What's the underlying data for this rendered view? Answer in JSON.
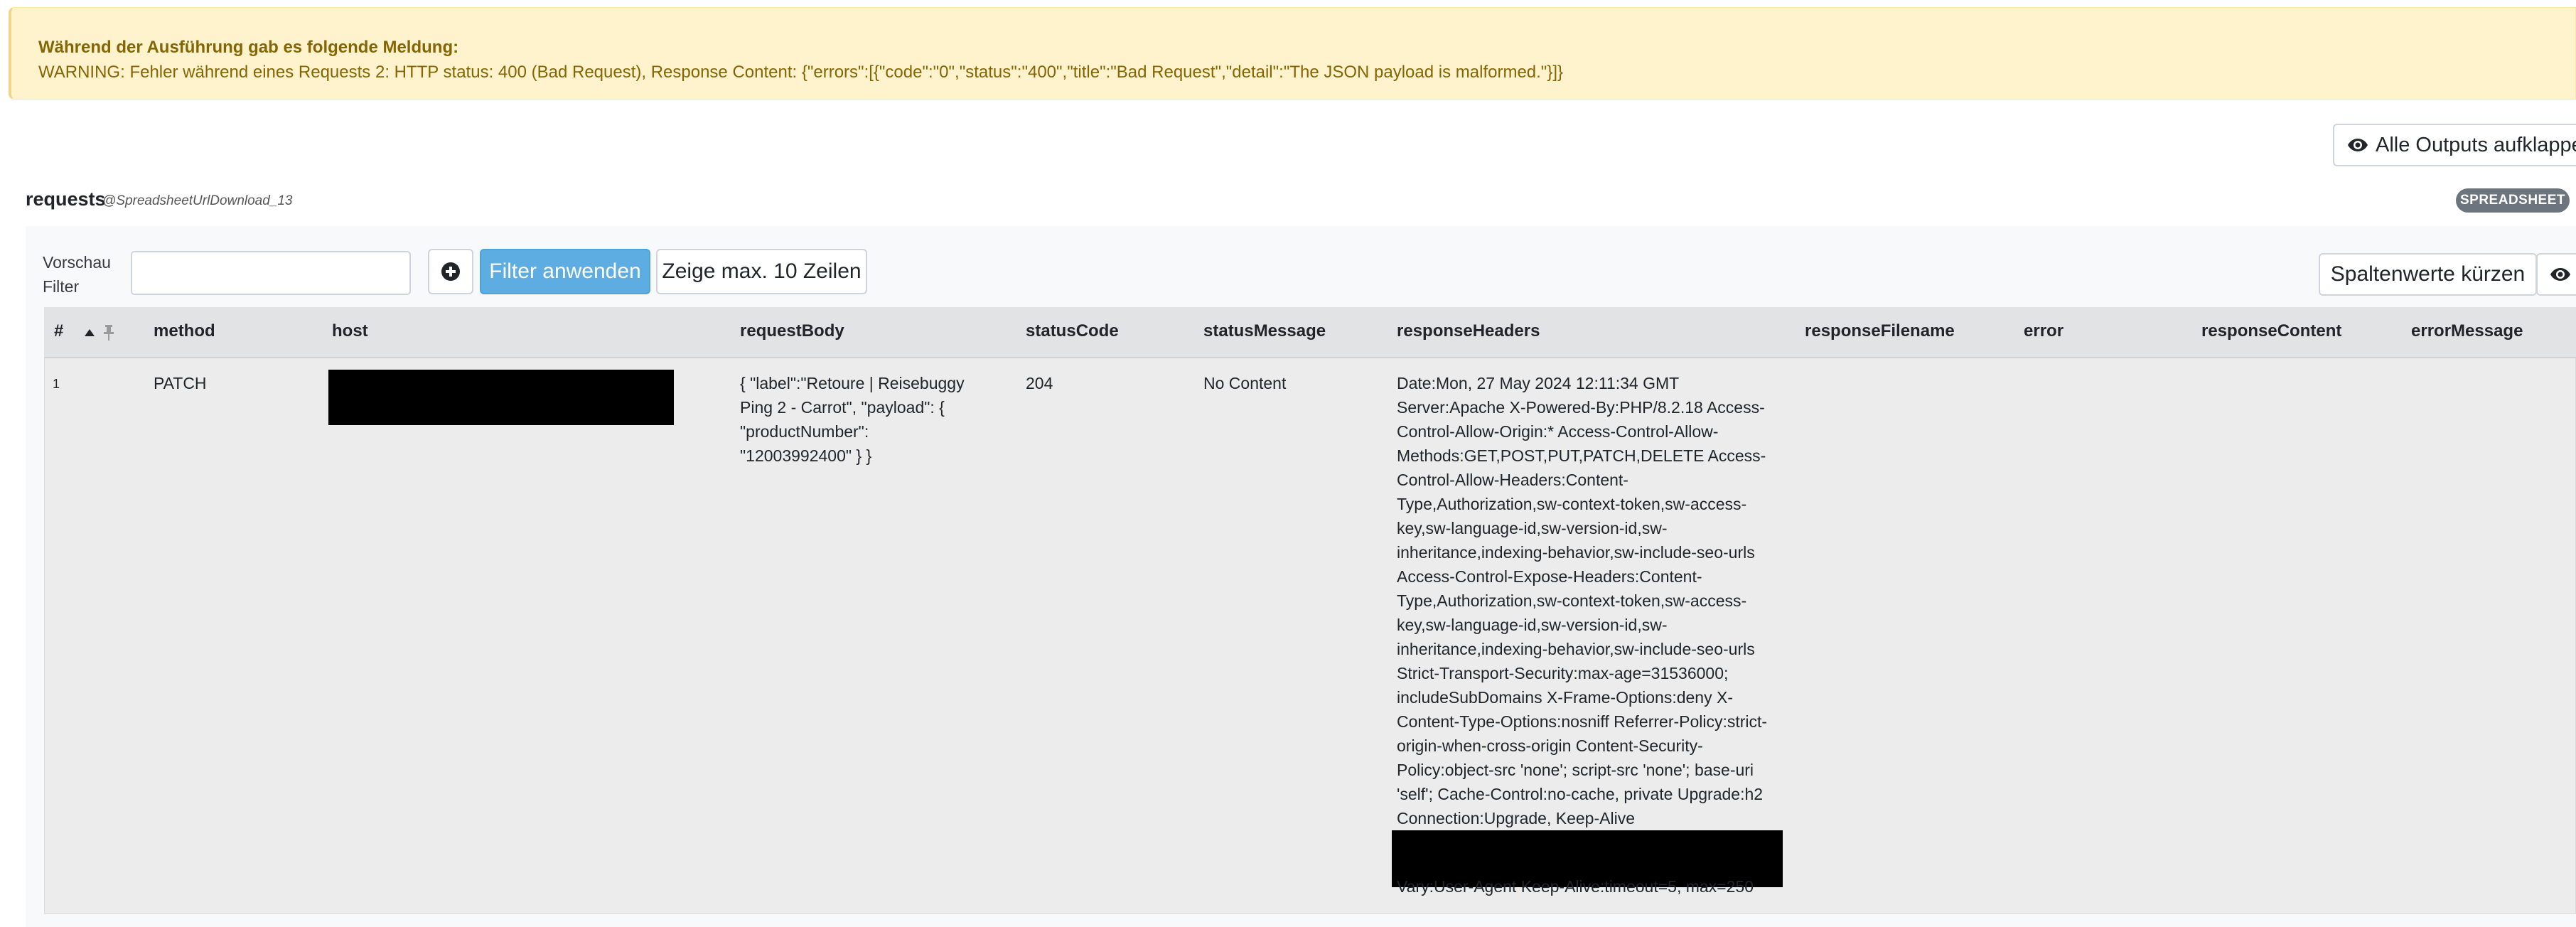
{
  "warning": {
    "title": "Während der Ausführung gab es folgende Meldung:",
    "message": "WARNING: Fehler während eines Requests 2: HTTP status: 400 (Bad Request), Response Content: {\"errors\":[{\"code\":\"0\",\"status\":\"400\",\"title\":\"Bad Request\",\"detail\":\"The JSON payload is malformed.\"}]}"
  },
  "toolbar": {
    "expand_all_label": "Alle Outputs aufklappen"
  },
  "output": {
    "name": "requests",
    "source": "@SpreadsheetUrlDownload_13",
    "badge": "SPREADSHEET"
  },
  "filter": {
    "label": "Vorschau Filter",
    "input_value": "",
    "apply_label": "Filter anwenden",
    "max_rows_label": "Zeige max. 10 Zeilen",
    "shorten_label": "Spaltenwerte kürzen"
  },
  "icons": {
    "expand": "eye-icon",
    "add": "plus-circle-icon",
    "sort": "sort-up-icon",
    "pin": "pin-icon",
    "toggle": "eye-icon"
  },
  "colors": {
    "warning_bg": "#fff3cd",
    "warning_text": "#856404",
    "primary_button": "#5dade2",
    "badge": "#6c757d"
  },
  "table": {
    "columns": [
      "#",
      "method",
      "host",
      "requestBody",
      "statusCode",
      "statusMessage",
      "responseHeaders",
      "responseFilename",
      "error",
      "responseContent",
      "errorMessage"
    ],
    "rows": [
      {
        "num": "1",
        "method": "PATCH",
        "host": "",
        "requestBody": "{ \"label\":\"Retoure | Reisebuggy Ping 2 - Carrot\", \"payload\": { \"productNumber\": \"12003992400\" } }",
        "statusCode": "204",
        "statusMessage": "No Content",
        "responseHeaders": "Date:Mon, 27 May 2024 12:11:34 GMT Server:Apache X-Powered-By:PHP/8.2.18 Access-Control-Allow-Origin:* Access-Control-Allow-Methods:GET,POST,PUT,PATCH,DELETE Access-Control-Allow-Headers:Content-Type,Authorization,sw-context-token,sw-access-key,sw-language-id,sw-version-id,sw-inheritance,indexing-behavior,sw-include-seo-urls Access-Control-Expose-Headers:Content-Type,Authorization,sw-context-token,sw-access-key,sw-language-id,sw-version-id,sw-inheritance,indexing-behavior,sw-include-seo-urls Strict-Transport-Security:max-age=31536000; includeSubDomains X-Frame-Options:deny X-Content-Type-Options:nosniff Referrer-Policy:strict-origin-when-cross-origin Content-Security-Policy:object-src 'none'; script-src 'none'; base-uri 'self'; Cache-Control:no-cache, private Upgrade:h2 Connection:Upgrade, Keep-Alive",
        "responseHeadersTail": "Vary:User-Agent Keep-Alive:timeout=5, max=250",
        "responseFilename": "",
        "error": "",
        "responseContent": "",
        "errorMessage": ""
      }
    ]
  }
}
